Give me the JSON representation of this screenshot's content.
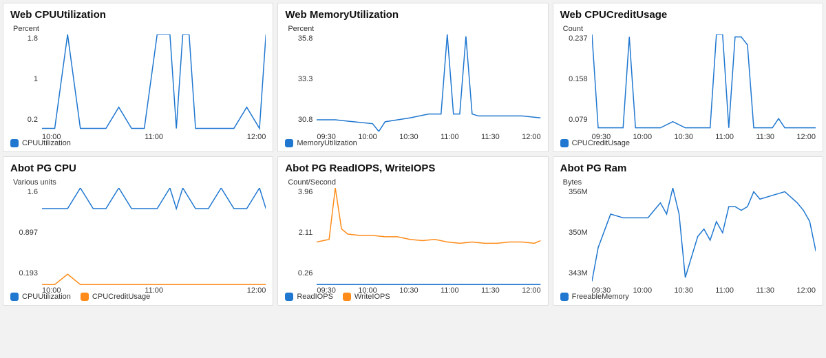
{
  "colors": {
    "blue": "#1f77d0",
    "orange": "#ff8c1a"
  },
  "panels": [
    {
      "id": "web-cpu",
      "title": "Web CPUUtilization",
      "unit": "Percent",
      "yticks": [
        "1.8",
        "1",
        "0.2"
      ],
      "xticks": [
        "10:00",
        "11:00",
        "12:00"
      ],
      "legend": [
        {
          "name": "CPUUtilization",
          "color": "blue"
        }
      ]
    },
    {
      "id": "web-mem",
      "title": "Web MemoryUtilization",
      "unit": "Percent",
      "yticks": [
        "35.8",
        "33.3",
        "30.8"
      ],
      "xticks": [
        "09:30",
        "10:00",
        "10:30",
        "11:00",
        "11:30",
        "12:00"
      ],
      "legend": [
        {
          "name": "MemoryUtilization",
          "color": "blue"
        }
      ]
    },
    {
      "id": "web-cpucredit",
      "title": "Web CPUCreditUsage",
      "unit": "Count",
      "yticks": [
        "0.237",
        "0.158",
        "0.079"
      ],
      "xticks": [
        "09:30",
        "10:00",
        "10:30",
        "11:00",
        "11:30",
        "12:00"
      ],
      "legend": [
        {
          "name": "CPUCreditUsage",
          "color": "blue"
        }
      ]
    },
    {
      "id": "abot-pg-cpu",
      "title": "Abot PG CPU",
      "unit": "Various units",
      "yticks": [
        "1.6",
        "0.897",
        "0.193"
      ],
      "xticks": [
        "10:00",
        "11:00",
        "12:00"
      ],
      "legend": [
        {
          "name": "CPUUtilization",
          "color": "blue"
        },
        {
          "name": "CPUCreditUsage",
          "color": "orange"
        }
      ]
    },
    {
      "id": "abot-pg-iops",
      "title": "Abot PG ReadIOPS, WriteIOPS",
      "unit": "Count/Second",
      "yticks": [
        "3.96",
        "2.11",
        "0.26"
      ],
      "xticks": [
        "09:30",
        "10:00",
        "10:30",
        "11:00",
        "11:30",
        "12:00"
      ],
      "legend": [
        {
          "name": "ReadIOPS",
          "color": "blue"
        },
        {
          "name": "WriteIOPS",
          "color": "orange"
        }
      ]
    },
    {
      "id": "abot-pg-ram",
      "title": "Abot PG Ram",
      "unit": "Bytes",
      "yticks": [
        "356M",
        "350M",
        "343M"
      ],
      "xticks": [
        "09:30",
        "10:00",
        "10:30",
        "11:00",
        "11:30",
        "12:00"
      ],
      "legend": [
        {
          "name": "FreeableMemory",
          "color": "blue"
        }
      ]
    }
  ],
  "chart_data": [
    {
      "panel": "web-cpu",
      "type": "line",
      "title": "Web CPUUtilization",
      "ylabel": "Percent",
      "ylim": [
        0.2,
        1.8
      ],
      "x_range": [
        "09:20",
        "12:15"
      ],
      "x_tick_labels": [
        "10:00",
        "11:00",
        "12:00"
      ],
      "series": [
        {
          "name": "CPUUtilization",
          "color": "#1f77d0",
          "x": [
            "09:20",
            "09:30",
            "09:40",
            "09:50",
            "10:00",
            "10:10",
            "10:20",
            "10:30",
            "10:40",
            "10:50",
            "11:00",
            "11:05",
            "11:10",
            "11:15",
            "11:20",
            "11:30",
            "11:40",
            "11:50",
            "12:00",
            "12:10",
            "12:15"
          ],
          "y": [
            0.25,
            0.25,
            1.8,
            0.25,
            0.25,
            0.25,
            0.6,
            0.25,
            0.25,
            1.8,
            1.8,
            0.25,
            1.8,
            1.8,
            0.25,
            0.25,
            0.25,
            0.25,
            0.6,
            0.25,
            1.8
          ]
        }
      ]
    },
    {
      "panel": "web-mem",
      "type": "line",
      "title": "Web MemoryUtilization",
      "ylabel": "Percent",
      "ylim": [
        30.8,
        35.8
      ],
      "x_range": [
        "09:15",
        "12:15"
      ],
      "x_tick_labels": [
        "09:30",
        "10:00",
        "10:30",
        "11:00",
        "11:30",
        "12:00"
      ],
      "series": [
        {
          "name": "MemoryUtilization",
          "color": "#1f77d0",
          "x": [
            "09:15",
            "09:30",
            "09:45",
            "10:00",
            "10:05",
            "10:10",
            "10:30",
            "10:45",
            "10:55",
            "11:00",
            "11:05",
            "11:10",
            "11:15",
            "11:20",
            "11:25",
            "11:45",
            "12:00",
            "12:15"
          ],
          "y": [
            31.4,
            31.4,
            31.3,
            31.2,
            30.8,
            31.3,
            31.5,
            31.7,
            31.7,
            35.8,
            31.7,
            31.7,
            35.7,
            31.7,
            31.6,
            31.6,
            31.6,
            31.5
          ]
        }
      ]
    },
    {
      "panel": "web-cpucredit",
      "type": "line",
      "title": "Web CPUCreditUsage",
      "ylabel": "Count",
      "ylim": [
        0.079,
        0.237
      ],
      "x_range": [
        "09:15",
        "12:15"
      ],
      "x_tick_labels": [
        "09:30",
        "10:00",
        "10:30",
        "11:00",
        "11:30",
        "12:00"
      ],
      "series": [
        {
          "name": "CPUCreditUsage",
          "color": "#1f77d0",
          "x": [
            "09:15",
            "09:20",
            "09:30",
            "09:40",
            "09:45",
            "09:50",
            "10:00",
            "10:10",
            "10:20",
            "10:30",
            "10:40",
            "10:50",
            "10:55",
            "11:00",
            "11:05",
            "11:10",
            "11:15",
            "11:20",
            "11:25",
            "11:30",
            "11:40",
            "11:45",
            "11:50",
            "12:00",
            "12:10",
            "12:15"
          ],
          "y": [
            0.237,
            0.085,
            0.085,
            0.085,
            0.233,
            0.085,
            0.085,
            0.085,
            0.095,
            0.085,
            0.085,
            0.085,
            0.237,
            0.237,
            0.085,
            0.233,
            0.233,
            0.22,
            0.085,
            0.085,
            0.085,
            0.1,
            0.085,
            0.085,
            0.085,
            0.085
          ]
        }
      ]
    },
    {
      "panel": "abot-pg-cpu",
      "type": "line",
      "title": "Abot PG CPU",
      "ylabel": "Various units",
      "ylim": [
        0.193,
        1.6
      ],
      "x_range": [
        "09:20",
        "12:15"
      ],
      "x_tick_labels": [
        "10:00",
        "11:00",
        "12:00"
      ],
      "series": [
        {
          "name": "CPUUtilization",
          "color": "#1f77d0",
          "x": [
            "09:20",
            "09:40",
            "09:50",
            "10:00",
            "10:10",
            "10:20",
            "10:30",
            "10:40",
            "10:50",
            "11:00",
            "11:05",
            "11:10",
            "11:20",
            "11:30",
            "11:40",
            "11:50",
            "12:00",
            "12:10",
            "12:15"
          ],
          "y": [
            1.3,
            1.3,
            1.6,
            1.3,
            1.3,
            1.6,
            1.3,
            1.3,
            1.3,
            1.6,
            1.3,
            1.6,
            1.3,
            1.3,
            1.6,
            1.3,
            1.3,
            1.6,
            1.3
          ]
        },
        {
          "name": "CPUCreditUsage",
          "color": "#ff8c1a",
          "x": [
            "09:20",
            "09:30",
            "09:40",
            "09:50",
            "10:00",
            "10:30",
            "11:00",
            "11:30",
            "12:00",
            "12:15"
          ],
          "y": [
            0.2,
            0.2,
            0.35,
            0.2,
            0.2,
            0.2,
            0.2,
            0.2,
            0.2,
            0.2
          ]
        }
      ]
    },
    {
      "panel": "abot-pg-iops",
      "type": "line",
      "title": "Abot PG ReadIOPS, WriteIOPS",
      "ylabel": "Count/Second",
      "ylim": [
        0.26,
        3.96
      ],
      "x_range": [
        "09:15",
        "12:15"
      ],
      "x_tick_labels": [
        "09:30",
        "10:00",
        "10:30",
        "11:00",
        "11:30",
        "12:00"
      ],
      "series": [
        {
          "name": "ReadIOPS",
          "color": "#1f77d0",
          "x": [
            "09:15",
            "09:30",
            "10:00",
            "10:30",
            "11:00",
            "11:30",
            "12:00",
            "12:15"
          ],
          "y": [
            0.28,
            0.28,
            0.28,
            0.28,
            0.28,
            0.28,
            0.28,
            0.28
          ]
        },
        {
          "name": "WriteIOPS",
          "color": "#ff8c1a",
          "x": [
            "09:15",
            "09:25",
            "09:30",
            "09:35",
            "09:40",
            "09:50",
            "10:00",
            "10:10",
            "10:20",
            "10:30",
            "10:40",
            "10:50",
            "11:00",
            "11:10",
            "11:20",
            "11:30",
            "11:40",
            "11:50",
            "12:00",
            "12:10",
            "12:15"
          ],
          "y": [
            1.9,
            2.0,
            3.96,
            2.4,
            2.2,
            2.15,
            2.15,
            2.1,
            2.1,
            2.0,
            1.95,
            2.0,
            1.9,
            1.85,
            1.9,
            1.85,
            1.85,
            1.9,
            1.9,
            1.85,
            1.95
          ]
        }
      ]
    },
    {
      "panel": "abot-pg-ram",
      "type": "line",
      "title": "Abot PG Ram",
      "ylabel": "Bytes",
      "ylim": [
        343,
        356
      ],
      "y_tick_labels": [
        "356M",
        "350M",
        "343M"
      ],
      "x_range": [
        "09:15",
        "12:15"
      ],
      "x_tick_labels": [
        "09:30",
        "10:00",
        "10:30",
        "11:00",
        "11:30",
        "12:00"
      ],
      "series": [
        {
          "name": "FreeableMemory",
          "color": "#1f77d0",
          "x": [
            "09:15",
            "09:20",
            "09:30",
            "09:40",
            "09:50",
            "10:00",
            "10:05",
            "10:10",
            "10:15",
            "10:20",
            "10:25",
            "10:30",
            "10:40",
            "10:45",
            "10:50",
            "10:55",
            "11:00",
            "11:05",
            "11:10",
            "11:15",
            "11:20",
            "11:25",
            "11:30",
            "11:40",
            "11:50",
            "12:00",
            "12:05",
            "12:10",
            "12:15"
          ],
          "y": [
            343.5,
            348,
            352.5,
            352,
            352,
            352,
            353,
            354,
            352.5,
            356,
            352.5,
            344,
            349.5,
            350.5,
            349,
            351.5,
            350,
            353.5,
            353.5,
            353,
            353.5,
            355.5,
            354.5,
            355,
            355.5,
            354,
            353,
            351.5,
            347.5
          ]
        }
      ]
    }
  ]
}
